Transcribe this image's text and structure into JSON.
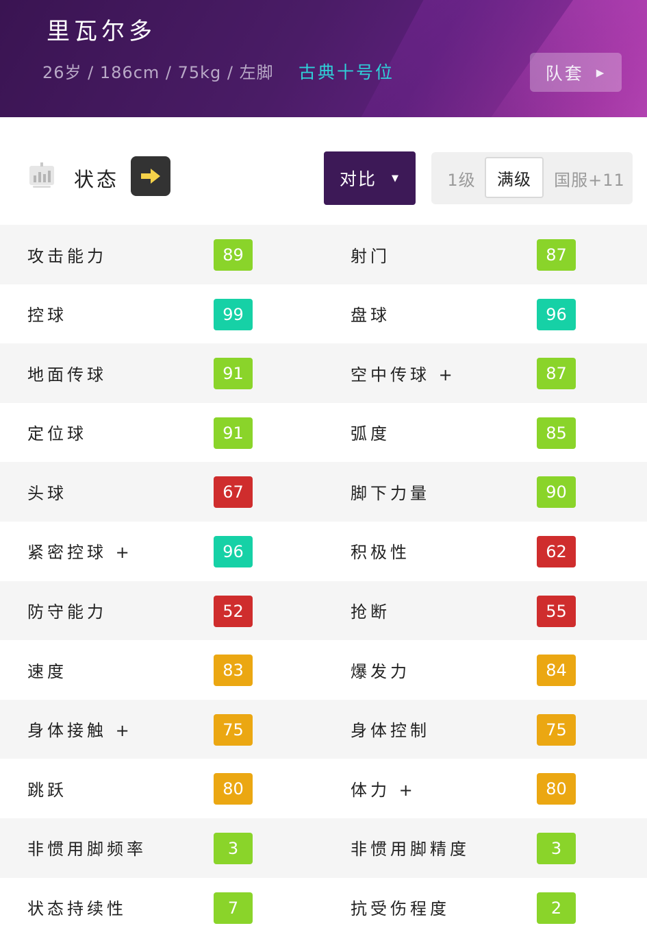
{
  "header": {
    "name": "里瓦尔多",
    "meta": "26岁 / 186cm / 75kg / 左脚",
    "role": "古典十号位",
    "team_button": "队套"
  },
  "toolbar": {
    "status_label": "状态",
    "compare_button": "对比",
    "levels": [
      "1级",
      "满级",
      "国服+11"
    ],
    "selected_level": "满级"
  },
  "colors": {
    "green": "#8ad42a",
    "teal": "#16d1a6",
    "red": "#cf2d2d",
    "orange": "#eba712",
    "header_purple": "#3d1957",
    "role_cyan": "#2fd0d8"
  },
  "stats": [
    {
      "left": {
        "label": "攻击能力",
        "value": "89",
        "color": "green"
      },
      "right": {
        "label": "射门",
        "value": "87",
        "color": "green"
      }
    },
    {
      "left": {
        "label": "控球",
        "value": "99",
        "color": "teal"
      },
      "right": {
        "label": "盘球",
        "value": "96",
        "color": "teal"
      }
    },
    {
      "left": {
        "label": "地面传球",
        "value": "91",
        "color": "green"
      },
      "right": {
        "label": "空中传球 +",
        "value": "87",
        "color": "green"
      }
    },
    {
      "left": {
        "label": "定位球",
        "value": "91",
        "color": "green"
      },
      "right": {
        "label": "弧度",
        "value": "85",
        "color": "green"
      }
    },
    {
      "left": {
        "label": "头球",
        "value": "67",
        "color": "red"
      },
      "right": {
        "label": "脚下力量",
        "value": "90",
        "color": "green"
      }
    },
    {
      "left": {
        "label": "紧密控球 +",
        "value": "96",
        "color": "teal"
      },
      "right": {
        "label": "积极性",
        "value": "62",
        "color": "red"
      }
    },
    {
      "left": {
        "label": "防守能力",
        "value": "52",
        "color": "red"
      },
      "right": {
        "label": "抢断",
        "value": "55",
        "color": "red"
      }
    },
    {
      "left": {
        "label": "速度",
        "value": "83",
        "color": "orange"
      },
      "right": {
        "label": "爆发力",
        "value": "84",
        "color": "orange"
      }
    },
    {
      "left": {
        "label": "身体接触 +",
        "value": "75",
        "color": "orange"
      },
      "right": {
        "label": "身体控制",
        "value": "75",
        "color": "orange"
      }
    },
    {
      "left": {
        "label": "跳跃",
        "value": "80",
        "color": "orange"
      },
      "right": {
        "label": "体力 +",
        "value": "80",
        "color": "orange"
      }
    },
    {
      "left": {
        "label": "非惯用脚频率",
        "value": "3",
        "color": "green"
      },
      "right": {
        "label": "非惯用脚精度",
        "value": "3",
        "color": "green"
      }
    },
    {
      "left": {
        "label": "状态持续性",
        "value": "7",
        "color": "green"
      },
      "right": {
        "label": "抗受伤程度",
        "value": "2",
        "color": "green"
      }
    }
  ]
}
